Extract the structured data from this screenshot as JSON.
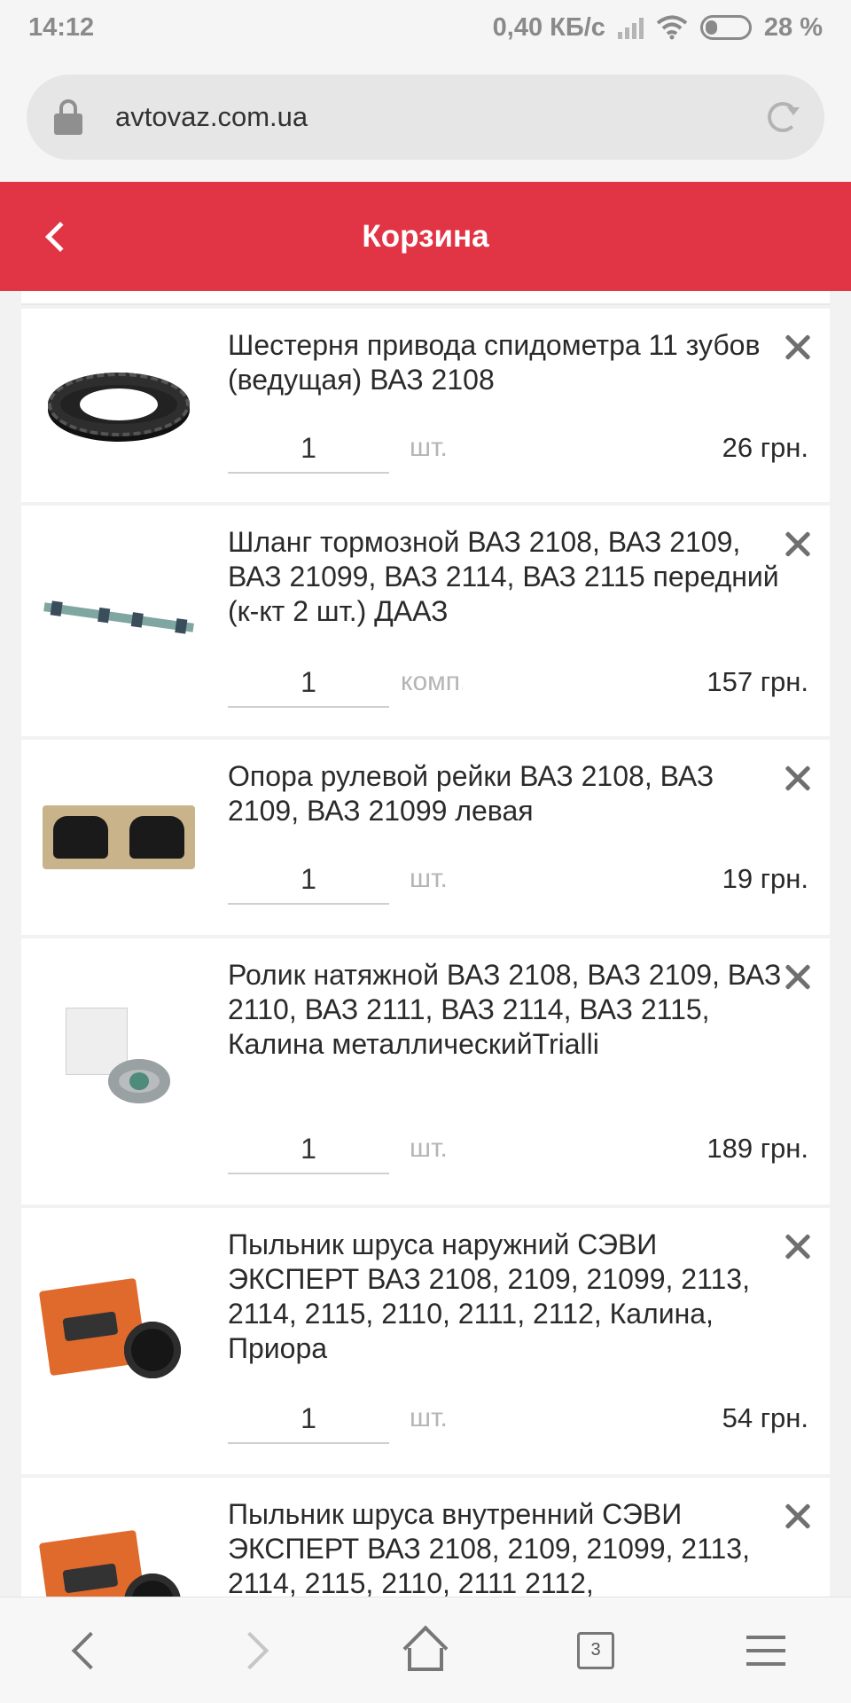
{
  "status_bar": {
    "time": "14:12",
    "network_speed": "0,40 КБ/с",
    "battery_percent": "28 %",
    "battery_level": 0.28,
    "icons": [
      "signal-icon",
      "wifi-icon",
      "battery-icon"
    ]
  },
  "browser": {
    "url": "avtovaz.com.ua",
    "tab_count": "3"
  },
  "header": {
    "title": "Корзина"
  },
  "cart": {
    "items": [
      {
        "name": "Шестерня привода спидометра 11 зубов (ведущая) ВАЗ 2108",
        "quantity": "1",
        "unit": "шт.",
        "price": "26 грн.",
        "image": "gear-thumbnail"
      },
      {
        "name": "Шланг тормозной ВАЗ 2108, ВАЗ 2109, ВАЗ 21099, ВАЗ 2114, ВАЗ 2115 передний (к-кт 2 шт.) ДААЗ",
        "quantity": "1",
        "unit": "комп.",
        "price": "157 грн.",
        "image": "brake-hose-thumbnail"
      },
      {
        "name": "Опора рулевой рейки ВАЗ 2108, ВАЗ 2109, ВАЗ 21099 левая",
        "quantity": "1",
        "unit": "шт.",
        "price": "19 грн.",
        "image": "steering-mount-thumbnail"
      },
      {
        "name": "Ролик натяжной ВАЗ 2108, ВАЗ 2109, ВАЗ 2110, ВАЗ 2111, ВАЗ 2114, ВАЗ 2115, Калина металлическийTrialli",
        "quantity": "1",
        "unit": "шт.",
        "price": "189 грн.",
        "image": "tension-roller-thumbnail"
      },
      {
        "name": "Пыльник шруса наружний СЭВИ ЭКСПЕРТ ВАЗ 2108, 2109, 21099, 2113, 2114, 2115, 2110, 2111, 2112, Калина, Приора",
        "quantity": "1",
        "unit": "шт.",
        "price": "54 грн.",
        "image": "cv-boot-thumbnail"
      },
      {
        "name": "Пыльник шруса внутренний СЭВИ ЭКСПЕРТ ВАЗ 2108, 2109, 21099, 2113, 2114, 2115, 2110, 2111 2112,",
        "image": "cv-boot-thumbnail"
      }
    ]
  },
  "colors": {
    "header_bg": "#e13545",
    "page_bg": "#f2f2f2"
  }
}
